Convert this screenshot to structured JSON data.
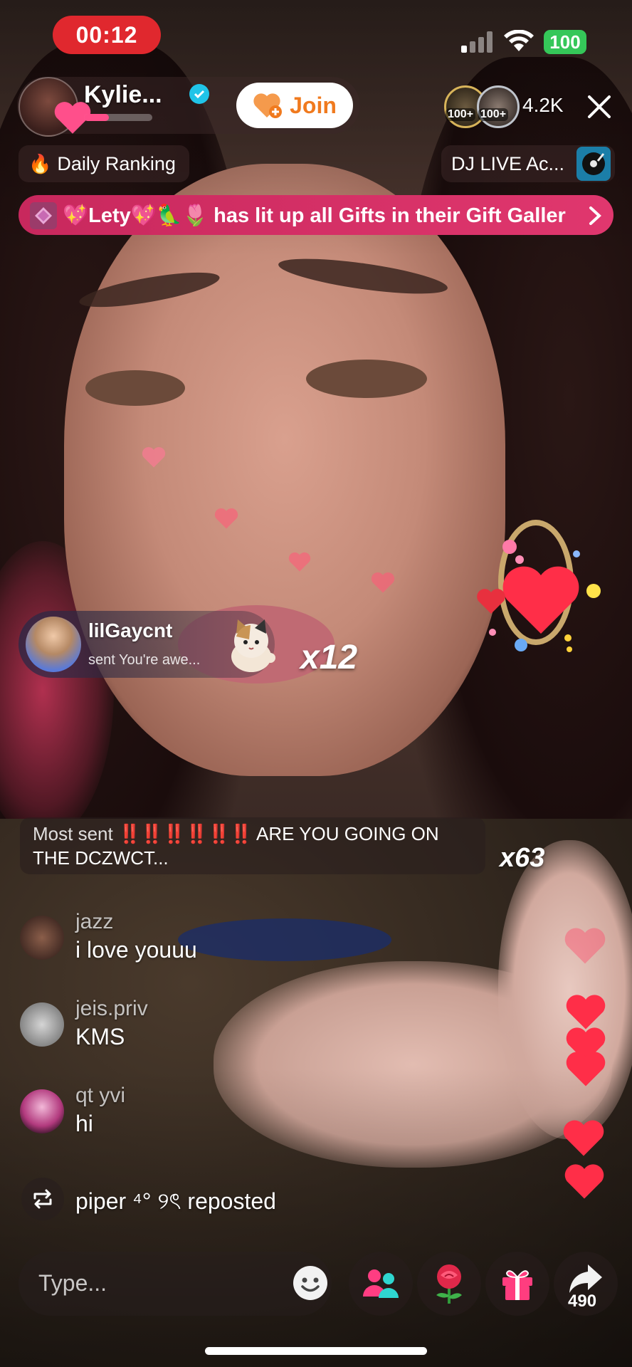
{
  "status_bar": {
    "time": "00:12",
    "battery": "100"
  },
  "host": {
    "name": "Kylie...",
    "join_label": "Join"
  },
  "viewers": {
    "badge1": "100+",
    "badge2": "100+",
    "count": "4.2K"
  },
  "top_row": {
    "ranking_label": "Daily Ranking",
    "dj_label": "DJ LIVE Ac..."
  },
  "banner": {
    "text": "💖Lety💖🦜🌷 has lit up all Gifts in their Gift Galler"
  },
  "gift_popup": {
    "user": "lilGaycnt",
    "message": "sent You're awe...",
    "count": "x12"
  },
  "most_sent": {
    "prefix": "Most sent",
    "marks": "‼️‼️‼️‼️‼️‼️",
    "text_line1": "ARE YOU GOING ON",
    "text_line2": "THE DCZWCT...",
    "count": "x63"
  },
  "chat": [
    {
      "name": "jazz",
      "message": "i love youuu"
    },
    {
      "name": "jeis.priv",
      "message": "KMS"
    },
    {
      "name": "qt yvi",
      "message": "hi"
    }
  ],
  "repost": {
    "text": "piper ⁴° ୨ৎ reposted"
  },
  "bottom_bar": {
    "input_placeholder": "Type...",
    "share_count": "490"
  },
  "colors": {
    "accent_pink": "#e8386d",
    "timer_red": "#e0282e",
    "battery_green": "#35c759",
    "verified_cyan": "#20c4e8",
    "join_orange": "#f07a1e"
  }
}
